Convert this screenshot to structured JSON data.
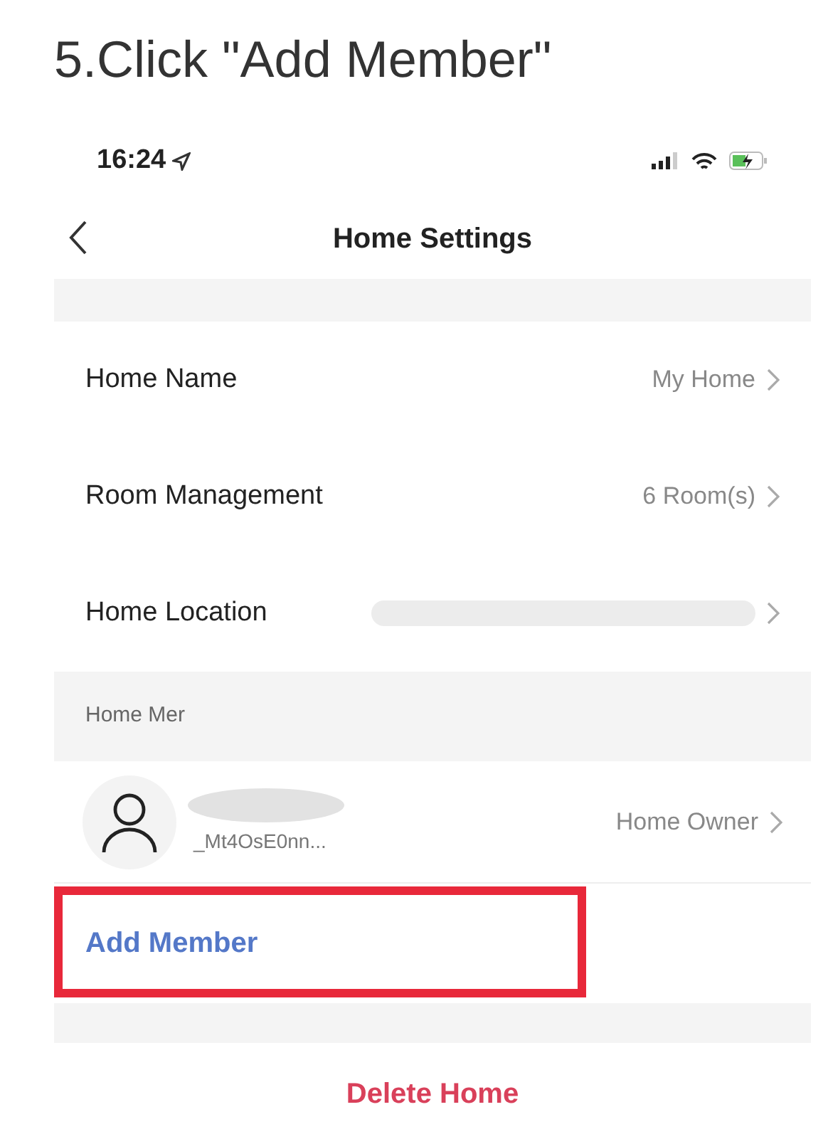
{
  "instruction": "5.Click \"Add Member\"",
  "status_bar": {
    "time": "16:24"
  },
  "nav": {
    "title": "Home Settings"
  },
  "settings": [
    {
      "label": "Home Name",
      "value": "My Home",
      "redacted": false
    },
    {
      "label": "Room Management",
      "value": "6 Room(s)",
      "redacted": false
    },
    {
      "label": "Home Location",
      "redacted": true
    }
  ],
  "members_section": {
    "header": "Home Mer",
    "members": [
      {
        "id": "_Mt4OsE0nn...",
        "role": "Home Owner"
      }
    ],
    "add_button": {
      "label": "Add Member",
      "highlighted": true
    }
  },
  "delete_button": "Delete Home"
}
